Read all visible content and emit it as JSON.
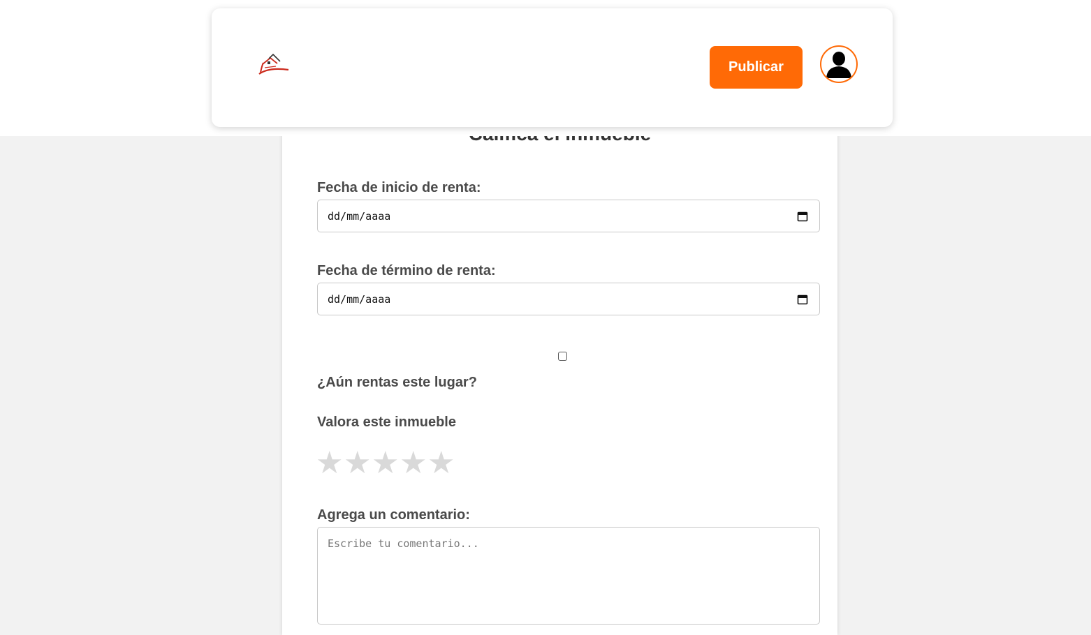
{
  "header": {
    "publish_label": "Publicar"
  },
  "form": {
    "title": "Califica el inmueble",
    "start_date": {
      "label": "Fecha de inicio de renta:",
      "value": "dd/mm/aaaa"
    },
    "end_date": {
      "label": "Fecha de término de renta:",
      "value": "dd/mm/aaaa"
    },
    "still_renting": {
      "label": "¿Aún rentas este lugar?",
      "checked": false
    },
    "rating": {
      "label": "Valora este inmueble",
      "stars": [
        "★",
        "★",
        "★",
        "★",
        "★"
      ],
      "value": 0,
      "max": 5,
      "empty_color": "#d9d9d9"
    },
    "comment": {
      "label": "Agrega un comentario:",
      "placeholder": "Escribe tu comentario..."
    }
  },
  "colors": {
    "accent": "#ff6a06",
    "text": "#4a4a4a",
    "background": "#f2f2f2"
  },
  "icons": {
    "logo": "house-logo-icon",
    "avatar": "user-avatar-icon",
    "calendar": "calendar-icon"
  }
}
